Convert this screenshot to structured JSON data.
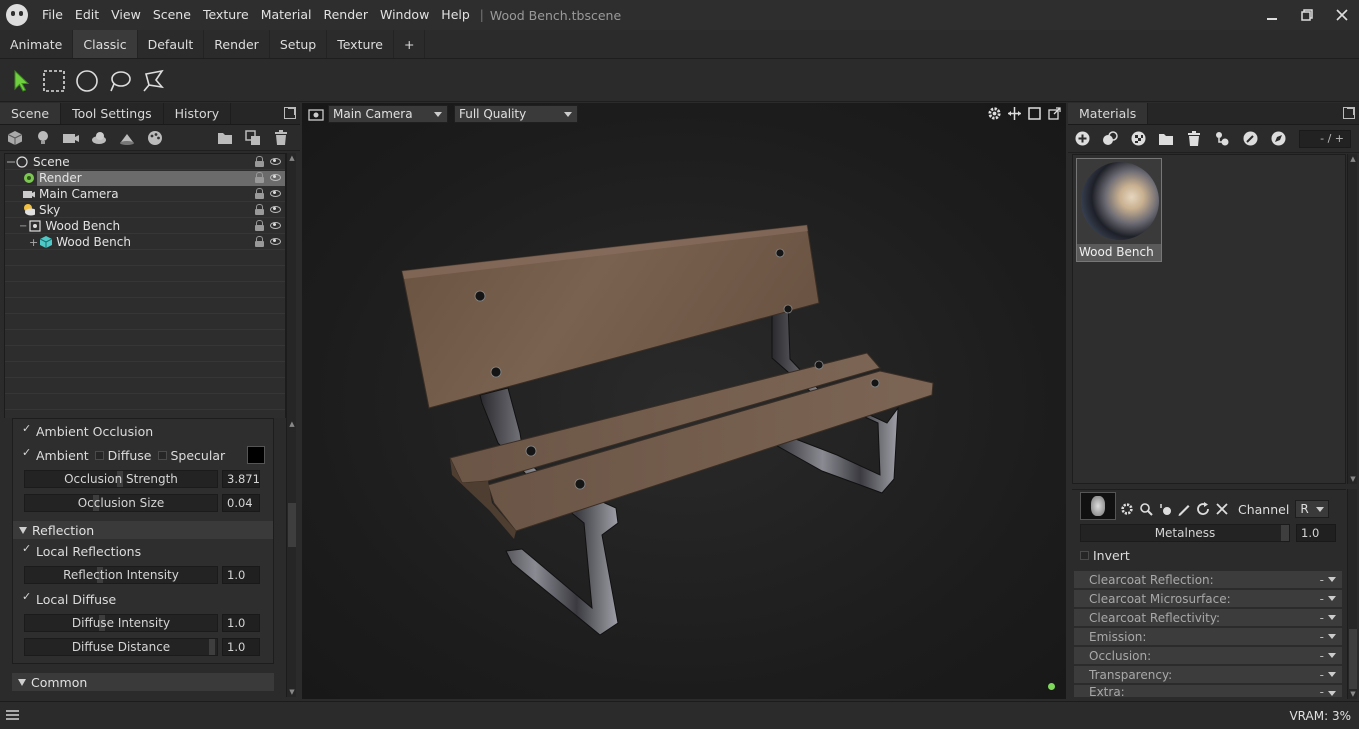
{
  "menu": [
    "File",
    "Edit",
    "View",
    "Scene",
    "Texture",
    "Material",
    "Render",
    "Window",
    "Help"
  ],
  "document_title": "Wood Bench.tbscene",
  "layout_tabs": [
    "Animate",
    "Classic",
    "Default",
    "Render",
    "Setup",
    "Texture",
    "+"
  ],
  "left_tabs": [
    "Scene",
    "Tool Settings",
    "History"
  ],
  "scene_tree": [
    {
      "label": "Scene",
      "indent": 0
    },
    {
      "label": "Render",
      "indent": 1,
      "selected": true
    },
    {
      "label": "Main Camera",
      "indent": 1
    },
    {
      "label": "Sky",
      "indent": 1
    },
    {
      "label": "Wood Bench",
      "indent": 1
    },
    {
      "label": "Wood Bench",
      "indent": 2
    }
  ],
  "ao": {
    "header": "Ambient Occlusion",
    "ambient": "Ambient",
    "diffuse": "Diffuse",
    "specular": "Specular",
    "strength_label": "Occlusion Strength",
    "strength_value": "3.871",
    "size_label": "Occlusion Size",
    "size_value": "0.04",
    "ambient_color": "#000000"
  },
  "reflection": {
    "header": "Reflection",
    "local_reflections": "Local Reflections",
    "intensity_label": "Reflection Intensity",
    "intensity_value": "1.0",
    "local_diffuse": "Local Diffuse",
    "diffuse_intensity_label": "Diffuse Intensity",
    "diffuse_intensity_value": "1.0",
    "diffuse_distance_label": "Diffuse Distance",
    "diffuse_distance_value": "1.0"
  },
  "common_header": "Common",
  "viewport": {
    "camera": "Main Camera",
    "quality": "Full Quality"
  },
  "materials": {
    "tab": "Materials",
    "page": "- / +",
    "selected_material": "Wood Bench",
    "channel_label": "Channel",
    "channel_value": "R",
    "metalness_label": "Metalness",
    "metalness_value": "1.0",
    "invert_label": "Invert",
    "channels": [
      "Clearcoat Reflection:",
      "Clearcoat Microsurface:",
      "Clearcoat Reflectivity:",
      "Emission:",
      "Occlusion:",
      "Transparency:",
      "Extra:"
    ],
    "channel_default": "-"
  },
  "status": {
    "vram": "VRAM: 3%"
  }
}
